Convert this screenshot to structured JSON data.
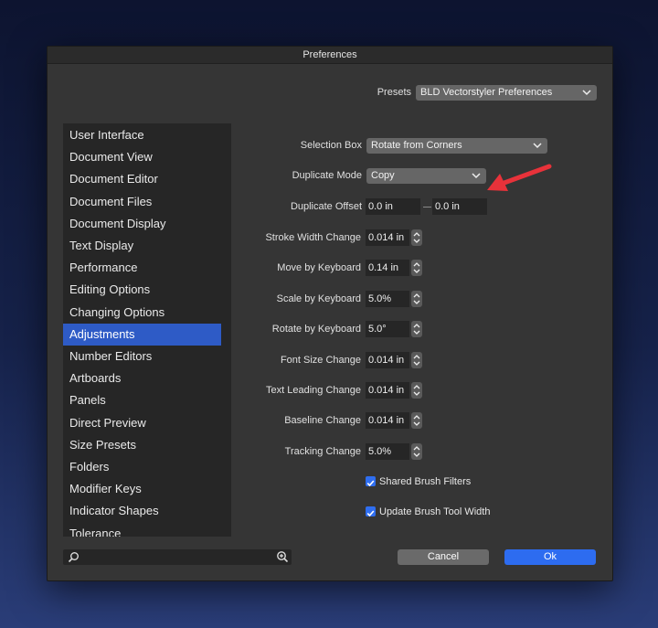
{
  "window": {
    "title": "Preferences"
  },
  "presets": {
    "label": "Presets",
    "value": "BLD Vectorstyler Preferences"
  },
  "sidebar": {
    "items": [
      {
        "label": "User Interface"
      },
      {
        "label": "Document View"
      },
      {
        "label": "Document Editor"
      },
      {
        "label": "Document Files"
      },
      {
        "label": "Document Display"
      },
      {
        "label": "Text Display"
      },
      {
        "label": "Performance"
      },
      {
        "label": "Editing Options"
      },
      {
        "label": "Changing Options"
      },
      {
        "label": "Adjustments"
      },
      {
        "label": "Number Editors"
      },
      {
        "label": "Artboards"
      },
      {
        "label": "Panels"
      },
      {
        "label": "Direct Preview"
      },
      {
        "label": "Size Presets"
      },
      {
        "label": "Folders"
      },
      {
        "label": "Modifier Keys"
      },
      {
        "label": "Indicator Shapes"
      },
      {
        "label": "Tolerance"
      }
    ],
    "selected": "Adjustments"
  },
  "settings": {
    "selection_box": {
      "label": "Selection Box",
      "value": "Rotate from Corners"
    },
    "duplicate_mode": {
      "label": "Duplicate Mode",
      "value": "Copy"
    },
    "duplicate_offset": {
      "label": "Duplicate Offset",
      "x": "0.0 in",
      "y": "0.0 in"
    },
    "stroke_width_change": {
      "label": "Stroke Width Change",
      "value": "0.014 in"
    },
    "move_by_keyboard": {
      "label": "Move by Keyboard",
      "value": "0.14 in"
    },
    "scale_by_keyboard": {
      "label": "Scale by Keyboard",
      "value": "5.0%"
    },
    "rotate_by_keyboard": {
      "label": "Rotate by Keyboard",
      "value": "5.0°"
    },
    "font_size_change": {
      "label": "Font Size Change",
      "value": "0.014 in"
    },
    "text_leading_change": {
      "label": "Text Leading Change",
      "value": "0.014 in"
    },
    "baseline_change": {
      "label": "Baseline Change",
      "value": "0.014 in"
    },
    "tracking_change": {
      "label": "Tracking Change",
      "value": "5.0%"
    },
    "shared_brush_filters": {
      "label": "Shared Brush Filters",
      "checked": true
    },
    "update_brush_tool_width": {
      "label": "Update Brush Tool Width",
      "checked": true
    }
  },
  "buttons": {
    "cancel": "Cancel",
    "ok": "Ok"
  },
  "icons": {
    "search": "search-icon",
    "zoom": "zoom-icon",
    "arrow": "red-arrow-annotation"
  },
  "colors": {
    "accent": "#2e5bc6",
    "arrow": "#e8323a"
  }
}
